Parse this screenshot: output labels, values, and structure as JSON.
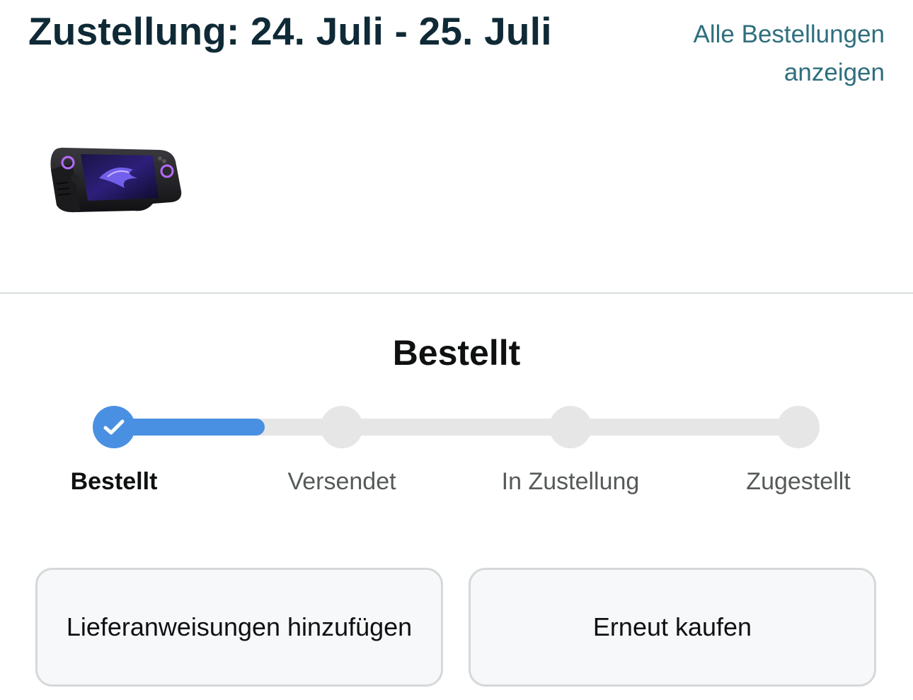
{
  "header": {
    "title": "Zustellung: 24. Juli - 25. Juli",
    "all_orders_link": "Alle Bestellungen anzeigen"
  },
  "product": {
    "image_icon": "handheld-console-image"
  },
  "status": {
    "title": "Bestellt",
    "progress_fraction": 0.22,
    "steps": [
      {
        "label": "Bestellt",
        "completed": true
      },
      {
        "label": "Versendet",
        "completed": false
      },
      {
        "label": "In Zustellung",
        "completed": false
      },
      {
        "label": "Zugestellt",
        "completed": false
      }
    ],
    "accent_color": "#4a90e2",
    "inactive_color": "#e6e6e6"
  },
  "actions": {
    "delivery_instructions_label": "Lieferanweisungen hinzufügen",
    "buy_again_label": "Erneut kaufen"
  },
  "colors": {
    "title": "#0f2a36",
    "link": "#2f6f7e"
  }
}
